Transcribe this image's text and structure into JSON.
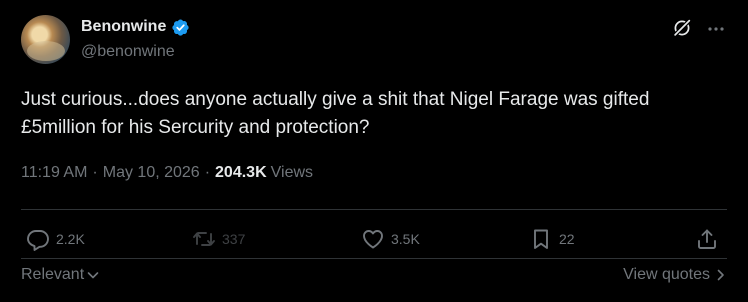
{
  "author": {
    "display_name": "Benonwine",
    "handle": "@benonwine",
    "verified": true
  },
  "tweet": {
    "text": "Just curious...does anyone actually give a shit that Nigel Farage was gifted £5million for his Sercurity and protection?",
    "time": "11:19 AM",
    "date": "May 10, 2026",
    "separator": "·",
    "views_count": "204.3K",
    "views_label": "Views"
  },
  "actions": {
    "replies": "2.2K",
    "reposts": "337",
    "likes": "3.5K",
    "bookmarks": "22"
  },
  "footer": {
    "sort_label": "Relevant",
    "view_quotes_label": "View quotes"
  },
  "icons": {
    "verified": "verified-badge-icon",
    "grok": "grok-icon",
    "more": "more-icon",
    "reply": "reply-icon",
    "repost": "repost-icon",
    "like": "heart-icon",
    "bookmark": "bookmark-icon",
    "share": "share-icon"
  },
  "colors": {
    "background": "#000000",
    "text": "#e7e9ea",
    "muted": "#71767b",
    "verified_blue": "#1d9bf0",
    "divider": "#2f3336"
  }
}
